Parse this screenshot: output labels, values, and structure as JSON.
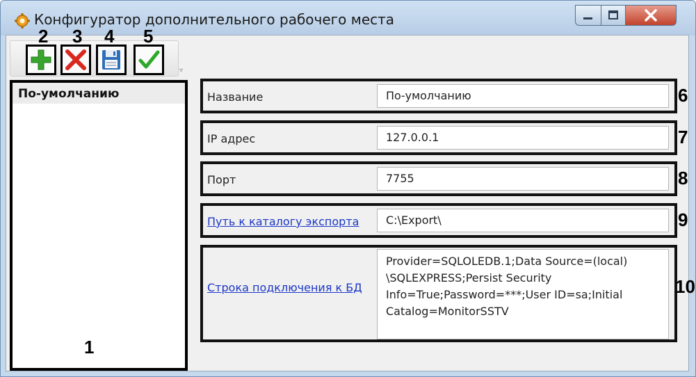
{
  "window": {
    "title": "Конфигуратор дополнительного рабочего места",
    "icon": "gear-icon",
    "controls": [
      "minimize",
      "maximize",
      "close"
    ]
  },
  "toolbar": {
    "buttons": [
      {
        "id": "add",
        "icon": "plus-icon",
        "color": "#3aa52e"
      },
      {
        "id": "delete",
        "icon": "cross-icon",
        "color": "#d8281f"
      },
      {
        "id": "save",
        "icon": "floppy-disk-icon",
        "color": "#2d6fb8"
      },
      {
        "id": "apply",
        "icon": "checkmark-icon",
        "color": "#2ea82a"
      }
    ]
  },
  "callouts": {
    "c1": "1",
    "c2": "2",
    "c3": "3",
    "c4": "4",
    "c5": "5",
    "c6": "6",
    "c7": "7",
    "c8": "8",
    "c9": "9",
    "c10": "10"
  },
  "profiles": {
    "items": [
      {
        "label": "По-умолчанию",
        "selected": true
      }
    ]
  },
  "fields": {
    "name": {
      "label": "Название",
      "value": "По-умолчанию"
    },
    "ip": {
      "label": "IP адрес",
      "value": "127.0.0.1"
    },
    "port": {
      "label": "Порт",
      "value": "7755"
    },
    "export_path": {
      "label": "Путь к каталогу экспорта",
      "value": "C:\\Export\\",
      "is_link": true
    },
    "connection_string": {
      "label": "Строка подключения к БД",
      "value": "Provider=SQLOLEDB.1;Data Source=(local)\n\\SQLEXPRESS;Persist Security\nInfo=True;Password=***;User ID=sa;Initial\nCatalog=MonitorSSTV",
      "is_link": true
    }
  }
}
